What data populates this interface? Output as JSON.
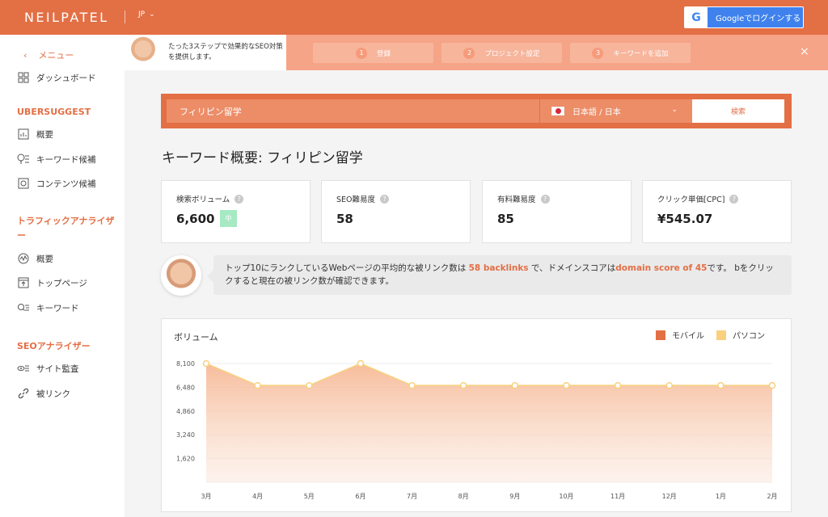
{
  "header": {
    "logo": "NEILPATEL",
    "lang_code": "JP",
    "google_login": "Googleでログインする"
  },
  "sidebar": {
    "back_label": "メニュー",
    "dashboard": "ダッシュボード",
    "sections": [
      {
        "title": "UBERSUGGEST",
        "items": [
          "概要",
          "キーワード候補",
          "コンテンツ候補"
        ]
      },
      {
        "title": "トラフィックアナライザー",
        "items": [
          "概要",
          "トップページ",
          "キーワード"
        ]
      },
      {
        "title": "SEOアナライザー",
        "items": [
          "サイト監査",
          "被リンク"
        ]
      }
    ]
  },
  "onboarding": {
    "tip": "たった3ステップで効果的なSEO対策を提供します。",
    "steps": [
      {
        "num": "1",
        "label": "登録"
      },
      {
        "num": "2",
        "label": "プロジェクト設定"
      },
      {
        "num": "3",
        "label": "キーワードを追加"
      }
    ],
    "close": "×"
  },
  "search": {
    "query": "フィリピン留学",
    "language": "日本語 / 日本",
    "button": "検索"
  },
  "page_title": "キーワード概要: フィリピン留学",
  "metrics": [
    {
      "label": "検索ボリューム",
      "value": "6,600",
      "badge": "中"
    },
    {
      "label": "SEO難易度",
      "value": "58"
    },
    {
      "label": "有料難易度",
      "value": "85"
    },
    {
      "label": "クリック単価[CPC]",
      "value": "¥545.07"
    }
  ],
  "info": {
    "part1": "トップ10にランクしているWebページの平均的な被リンク数は ",
    "hl1": "58 backlinks",
    "part2": " で、ドメインスコアは",
    "hl2": "domain score of 45",
    "part3": "です。 bをクリックすると現在の被リンク数が確認できます。"
  },
  "colors": {
    "accent": "#e36f45",
    "mobile": "#e36f45",
    "desktop": "#f8d07e"
  },
  "chart_data": {
    "type": "area",
    "title": "ボリューム",
    "categories": [
      "3月",
      "4月",
      "5月",
      "6月",
      "7月",
      "8月",
      "9月",
      "10月",
      "11月",
      "12月",
      "1月",
      "2月"
    ],
    "series": [
      {
        "name": "パソコン",
        "values": [
          8100,
          6600,
          6600,
          8100,
          6600,
          6600,
          6600,
          6600,
          6600,
          6600,
          6600,
          6600
        ]
      }
    ],
    "legend": [
      "モバイル",
      "パソコン"
    ],
    "yticks": [
      1620,
      3240,
      4860,
      6480,
      8100
    ],
    "ytick_labels": [
      "1,620",
      "3,240",
      "4,860",
      "6,480",
      "8,100"
    ],
    "ylim": [
      0,
      8100
    ],
    "legend_position": "top-right",
    "grid": true
  }
}
